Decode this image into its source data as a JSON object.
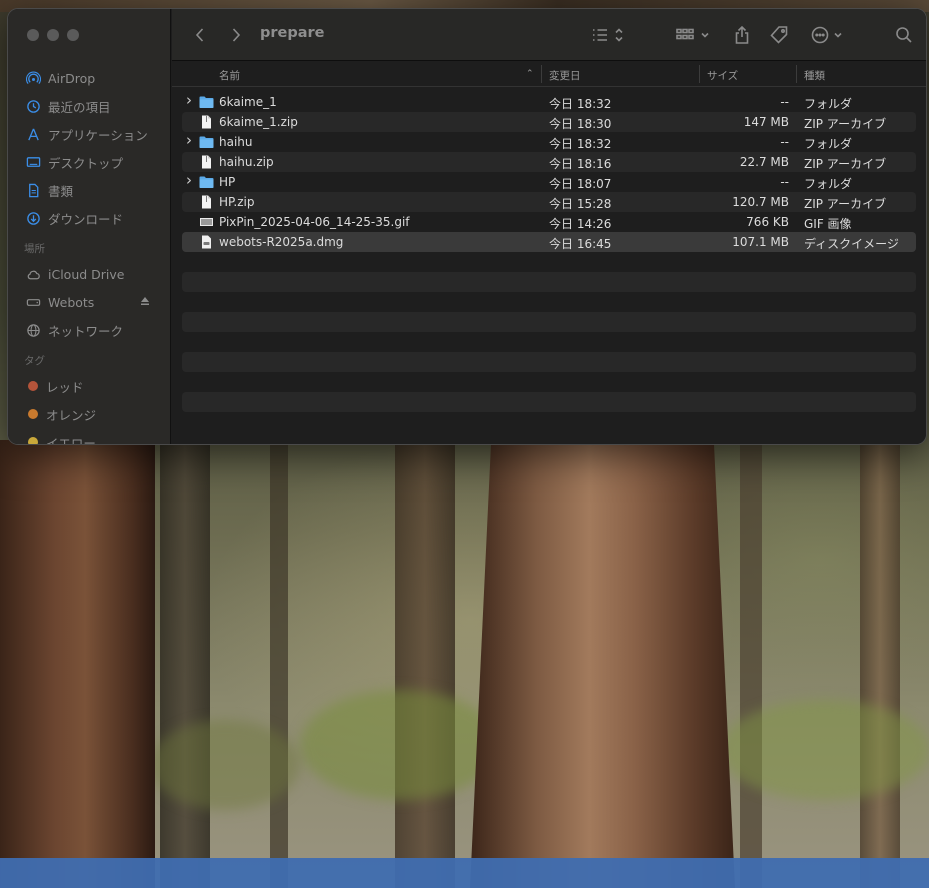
{
  "window": {
    "title": "prepare"
  },
  "sidebar": {
    "favorites": [
      {
        "label": "AirDrop",
        "icon": "airdrop-icon"
      },
      {
        "label": "最近の項目",
        "icon": "clock-icon"
      },
      {
        "label": "アプリケーション",
        "icon": "apps-icon"
      },
      {
        "label": "デスクトップ",
        "icon": "desktop-icon"
      },
      {
        "label": "書類",
        "icon": "document-icon"
      },
      {
        "label": "ダウンロード",
        "icon": "download-icon"
      }
    ],
    "locations_header": "場所",
    "locations": [
      {
        "label": "iCloud Drive",
        "icon": "cloud-icon"
      },
      {
        "label": "Webots",
        "icon": "disk-icon"
      },
      {
        "label": "ネットワーク",
        "icon": "globe-icon"
      }
    ],
    "tags_header": "タグ",
    "tags": [
      {
        "label": "レッド",
        "color": "#c0504a"
      },
      {
        "label": "オレンジ",
        "color": "#d6842e"
      },
      {
        "label": "イエロー",
        "color": "#d8b93a"
      }
    ]
  },
  "columns": {
    "name": "名前",
    "date": "変更日",
    "size": "サイズ",
    "kind": "種類"
  },
  "files": [
    {
      "name": "6kaime_1",
      "date": "今日 18:32",
      "size": "--",
      "kind": "フォルダ",
      "type": "folder"
    },
    {
      "name": "6kaime_1.zip",
      "date": "今日 18:30",
      "size": "147 MB",
      "kind": "ZIP アーカイブ",
      "type": "file"
    },
    {
      "name": "haihu",
      "date": "今日 18:32",
      "size": "--",
      "kind": "フォルダ",
      "type": "folder"
    },
    {
      "name": "haihu.zip",
      "date": "今日 18:16",
      "size": "22.7 MB",
      "kind": "ZIP アーカイブ",
      "type": "file"
    },
    {
      "name": "HP",
      "date": "今日 18:07",
      "size": "--",
      "kind": "フォルダ",
      "type": "folder"
    },
    {
      "name": "HP.zip",
      "date": "今日 15:28",
      "size": "120.7 MB",
      "kind": "ZIP アーカイブ",
      "type": "file"
    },
    {
      "name": "PixPin_2025-04-06_14-25-35.gif",
      "date": "今日 14:26",
      "size": "766 KB",
      "kind": "GIF 画像",
      "type": "image"
    },
    {
      "name": "webots-R2025a.dmg",
      "date": "今日 16:45",
      "size": "107.1 MB",
      "kind": "ディスクイメージ",
      "type": "dmg",
      "selected": true
    }
  ]
}
